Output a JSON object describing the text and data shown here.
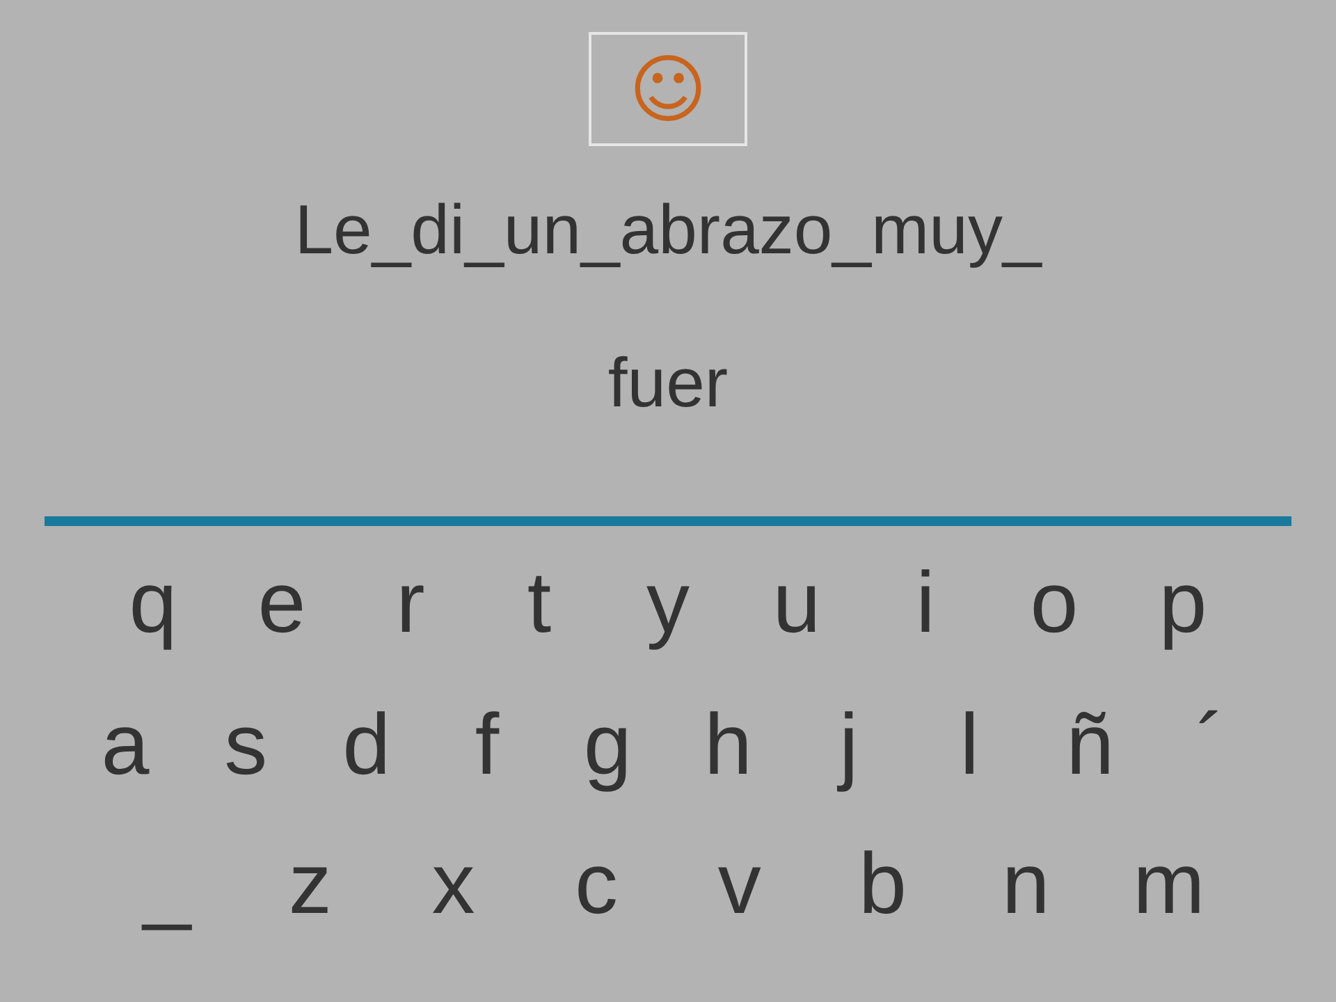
{
  "feedback": {
    "symbol": "☺"
  },
  "sentence": "Le_di_un_abrazo_muy_",
  "answer": "fuer",
  "keyboard": [
    [
      "q",
      "e",
      "r",
      "t",
      "y",
      "u",
      "i",
      "o",
      "p"
    ],
    [
      "a",
      "s",
      "d",
      "f",
      "g",
      "h",
      "j",
      "l",
      "ñ",
      "´"
    ],
    [
      "_",
      "z",
      "x",
      "c",
      "v",
      "b",
      "n",
      "m"
    ]
  ]
}
